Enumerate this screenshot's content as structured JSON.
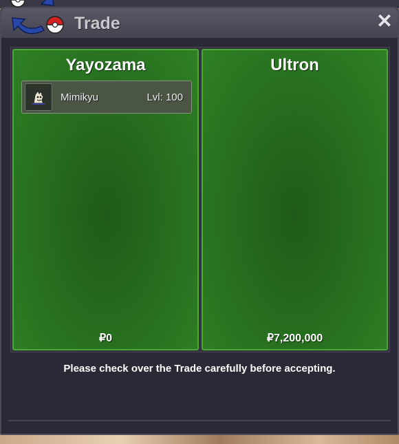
{
  "window": {
    "title": "Trade",
    "close_label": "✕"
  },
  "left_panel": {
    "player_name": "Yayozama",
    "pokemon": [
      {
        "name": "Mimikyu",
        "level": "Lvl: 100",
        "icon": "mimikyu-sprite-icon"
      }
    ],
    "money": "₽0"
  },
  "right_panel": {
    "player_name": "Ultron",
    "pokemon": [],
    "money": "₽7,200,000"
  },
  "notice": "Please check over the Trade carefully before accepting.",
  "colors": {
    "panel_green": "#276f1f",
    "panel_border": "#4aa83a",
    "window_bg": "#2a2935",
    "titlebar": "#4d4b58"
  }
}
